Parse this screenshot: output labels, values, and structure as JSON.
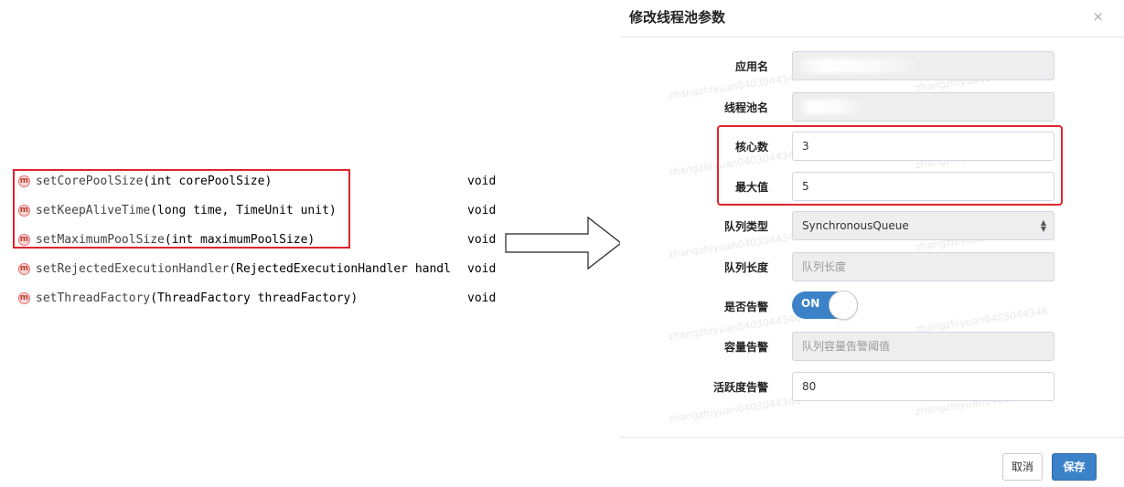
{
  "methods": [
    {
      "icon": "m",
      "name": "setCorePoolSize",
      "params": "(int corePoolSize)",
      "ret": "void"
    },
    {
      "icon": "m",
      "name": "setKeepAliveTime",
      "params": "(long time, TimeUnit unit)",
      "ret": "void"
    },
    {
      "icon": "m",
      "name": "setMaximumPoolSize",
      "params": "(int maximumPoolSize)",
      "ret": "void"
    },
    {
      "icon": "m",
      "name": "setRejectedExecutionHandler",
      "params": "(RejectedExecutionHandler handl",
      "ret": "void"
    },
    {
      "icon": "m",
      "name": "setThreadFactory",
      "params": "(ThreadFactory threadFactory)",
      "ret": "void"
    }
  ],
  "modal": {
    "title": "修改线程池参数",
    "close": "×",
    "fields": {
      "app_name_label": "应用名",
      "pool_name_label": "线程池名",
      "core_label": "核心数",
      "core_value": "3",
      "max_label": "最大值",
      "max_value": "5",
      "queue_type_label": "队列类型",
      "queue_type_value": "SynchronousQueue",
      "queue_len_label": "队列长度",
      "queue_len_placeholder": "队列长度",
      "alarm_label": "是否告警",
      "alarm_toggle": "ON",
      "capacity_alarm_label": "容量告警",
      "capacity_alarm_placeholder": "队列容量告警阈值",
      "activity_alarm_label": "活跃度告警",
      "activity_alarm_value": "80"
    },
    "buttons": {
      "cancel": "取消",
      "save": "保存"
    },
    "watermark": "zhangzhiyuan0403044346"
  },
  "colors": {
    "highlight_red": "#e0242c",
    "primary_blue": "#3c82c8"
  }
}
